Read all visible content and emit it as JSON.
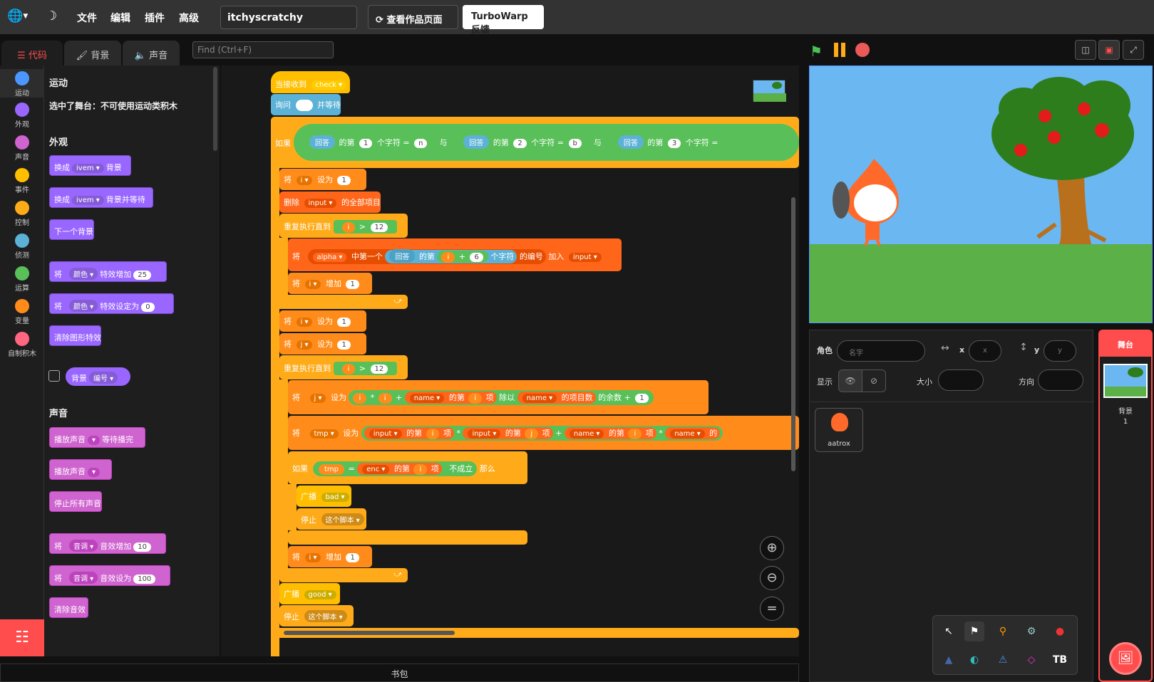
{
  "menu": {
    "file": "文件",
    "edit": "编辑",
    "addons": "插件",
    "advanced": "高级",
    "project_title": "itchyscratchy",
    "see_project": "查看作品页面",
    "feedback": "TurboWarp 反馈"
  },
  "tabs": {
    "code": "代码",
    "backdrops": "背景",
    "sounds": "声音"
  },
  "find": {
    "placeholder": "Find (Ctrl+F)"
  },
  "categories": [
    {
      "label": "运动",
      "color": "#4c97ff"
    },
    {
      "label": "外观",
      "color": "#9966ff"
    },
    {
      "label": "声音",
      "color": "#cf63cf"
    },
    {
      "label": "事件",
      "color": "#ffbf00"
    },
    {
      "label": "控制",
      "color": "#ffab19"
    },
    {
      "label": "侦测",
      "color": "#5cb1d6"
    },
    {
      "label": "运算",
      "color": "#59c059"
    },
    {
      "label": "变量",
      "color": "#ff8c1a"
    },
    {
      "label": "自制积木",
      "color": "#ff6680"
    }
  ],
  "palette": {
    "motion_h": "运动",
    "motion_note": "选中了舞台：不可使用运动类积木",
    "looks_h": "外观",
    "b1a": "换成",
    "b1b": "ivem",
    "b1c": "背景",
    "b2a": "换成",
    "b2b": "ivem",
    "b2c": "背景并等待",
    "b3": "下一个背景",
    "b4a": "将",
    "b4b": "颜色",
    "b4c": "特效增加",
    "b4d": "25",
    "b5a": "将",
    "b5b": "颜色",
    "b5c": "特效设定为",
    "b5d": "0",
    "b6": "清除图形特效",
    "b7a": "背景",
    "b7b": "编号",
    "sound_h": "声音",
    "s1a": "播放声音",
    "s1b": "等待播完",
    "s2a": "播放声音",
    "s3": "停止所有声音",
    "s4a": "将",
    "s4b": "音调",
    "s4c": "音效增加",
    "s4d": "10",
    "s5a": "将",
    "s5b": "音调",
    "s5c": "音效设为",
    "s5d": "100",
    "s6": "清除音效"
  },
  "script": {
    "hat_a": "当接收到",
    "hat_b": "check",
    "ask_a": "询问",
    "ask_b": "并等待",
    "if_a": "如果",
    "ans": "回答",
    "of_nth": "的第",
    "char": "个字符",
    "eq": "=",
    "and": "与",
    "n1": "1",
    "c1": "n",
    "n2": "2",
    "c2": "b",
    "n3": "3",
    "set": "将",
    "to": "设为",
    "i": "i",
    "one": "1",
    "j": "j",
    "del_a": "删除",
    "del_b": "input",
    "del_c": "的全部项目",
    "rep": "重复执行直到",
    "gt": ">",
    "twelve": "12",
    "alpha": "alpha",
    "in_one": "中第一个",
    "six": "6",
    "plus": "+",
    "char2": "个字符",
    "index": "的编号",
    "add": "加入",
    "input": "input",
    "change": "增加",
    "name": "name",
    "item": "项",
    "div": "除以",
    "len": "的项目数",
    "mod": "的余数",
    "mul": "*",
    "tmp": "tmp",
    "of": "的第",
    "of2": "的",
    "enc": "enc",
    "notok": "不成立",
    "then": "那么",
    "bcast": "广播",
    "bad": "bad",
    "good": "good",
    "stop": "停止",
    "this_script": "这个脚本"
  },
  "sprite_info": {
    "sprite": "角色",
    "name_ph": "名字",
    "x": "x",
    "y": "y",
    "show": "显示",
    "size": "大小",
    "direction": "方向"
  },
  "sprites": [
    {
      "name": "aatrox"
    }
  ],
  "stage_panel": {
    "title": "舞台",
    "backdrops_label": "背景",
    "backdrops_count": "1"
  },
  "backpack": "书包"
}
